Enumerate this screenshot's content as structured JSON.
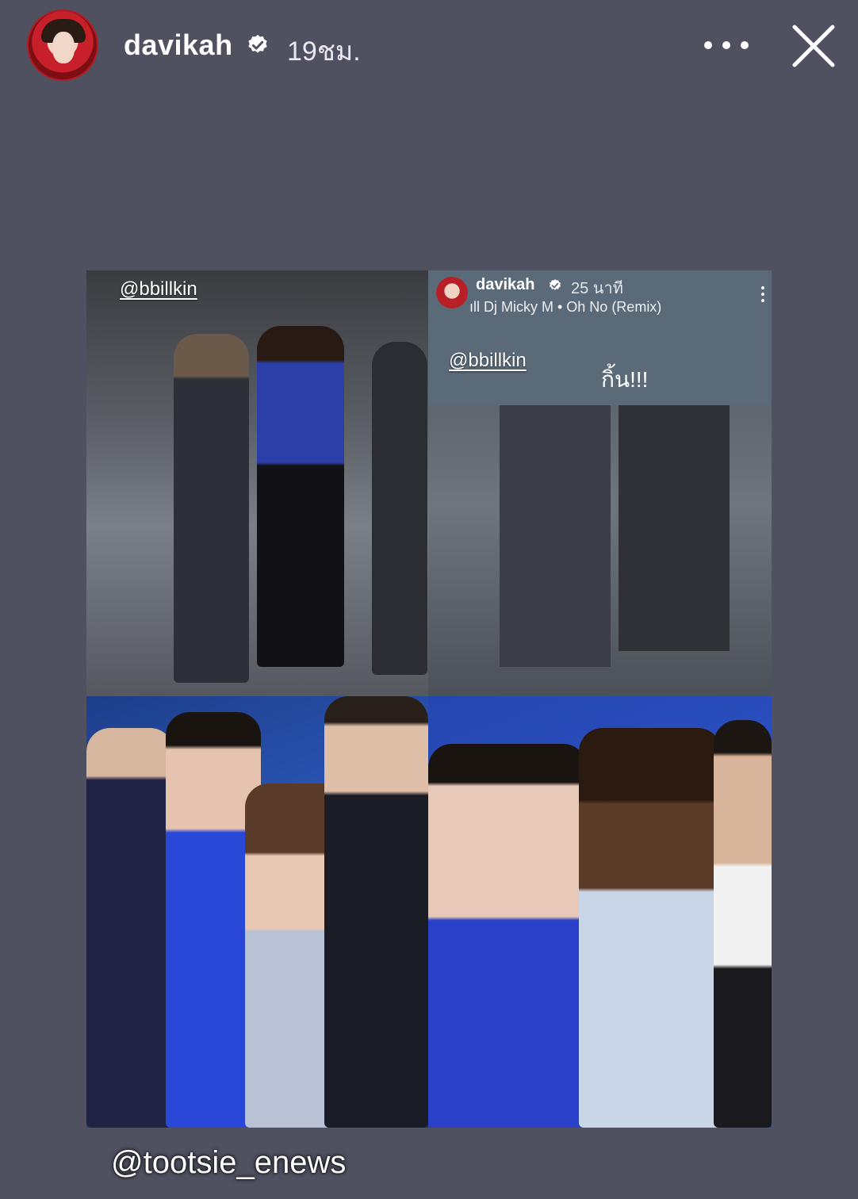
{
  "header": {
    "username": "davikah",
    "time": "19ชม."
  },
  "story": {
    "panel1": {
      "tag": "@bbillkin"
    },
    "panel2": {
      "username": "davikah",
      "time": "25 นาที",
      "music": "Dj Micky M • Oh No (Remix)",
      "tag": "@bbillkin",
      "caption": "กิ้น!!!"
    }
  },
  "credit": "@tootsie_enews",
  "colors": {
    "background": "#4f5060",
    "avatar_ring": "#b31a22"
  },
  "icons": {
    "verified": "verified-badge-icon",
    "more": "more-horizontal-icon",
    "close": "close-icon"
  }
}
